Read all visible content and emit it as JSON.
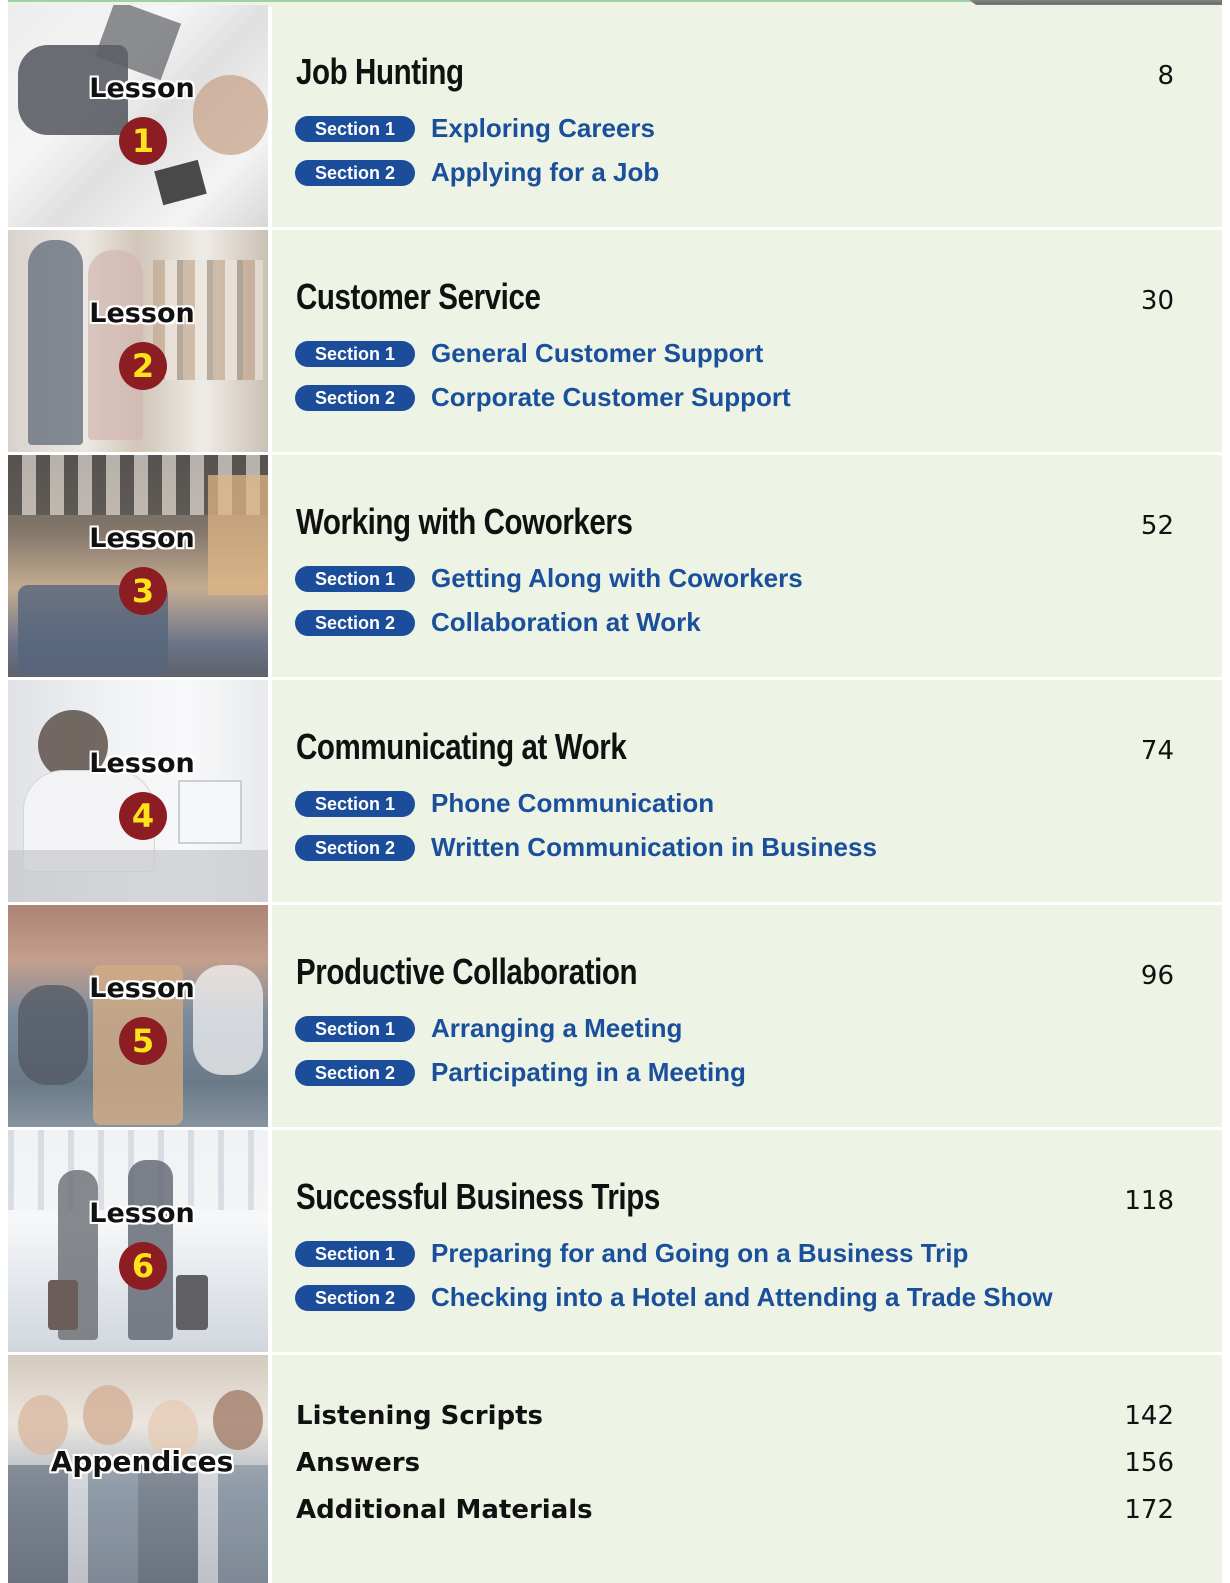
{
  "lesson_word": "Lesson",
  "section_labels": {
    "s1": "Section 1",
    "s2": "Section 2"
  },
  "lessons": [
    {
      "number": "1",
      "title": "Job Hunting",
      "page": "8",
      "sections": [
        "Exploring Careers",
        "Applying for a Job"
      ]
    },
    {
      "number": "2",
      "title": "Customer Service",
      "page": "30",
      "sections": [
        "General Customer Support",
        "Corporate Customer Support"
      ]
    },
    {
      "number": "3",
      "title": "Working with Coworkers",
      "page": "52",
      "sections": [
        "Getting Along with Coworkers",
        "Collaboration at Work"
      ]
    },
    {
      "number": "4",
      "title": "Communicating at Work",
      "page": "74",
      "sections": [
        "Phone Communication",
        "Written Communication in Business"
      ]
    },
    {
      "number": "5",
      "title": "Productive Collaboration",
      "page": "96",
      "sections": [
        "Arranging a Meeting",
        "Participating in a Meeting"
      ]
    },
    {
      "number": "6",
      "title": "Successful Business Trips",
      "page": "118",
      "sections": [
        "Preparing for and Going on a Business Trip",
        "Checking into a Hotel and Attending a Trade Show"
      ]
    }
  ],
  "appendices": {
    "label": "Appendices",
    "items": [
      {
        "name": "Listening Scripts",
        "page": "142"
      },
      {
        "name": "Answers",
        "page": "156"
      },
      {
        "name": "Additional Materials",
        "page": "172"
      }
    ]
  },
  "colors": {
    "panel_bg": "#edf4e5",
    "badge_bg": "#1b4d9a",
    "section_text": "#1a4f9c",
    "number_circle": "#8c1d22",
    "number_text": "#ffe31a"
  }
}
